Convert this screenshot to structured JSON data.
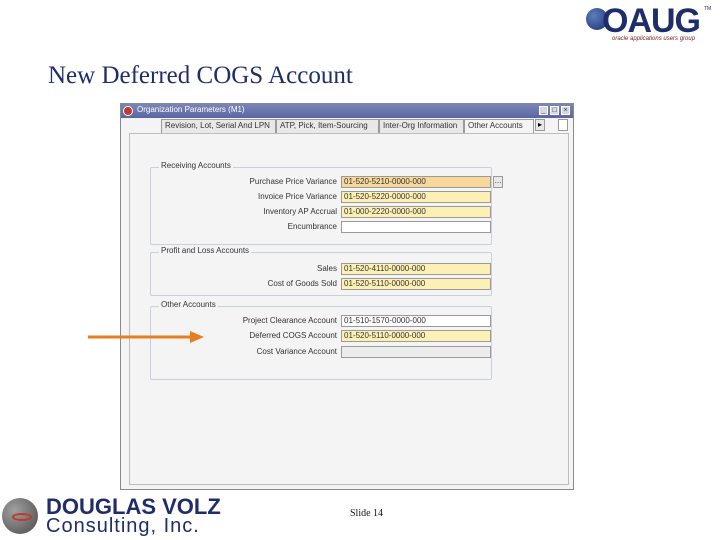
{
  "slide": {
    "title": "New Deferred COGS Account",
    "slide_number": "Slide 14"
  },
  "header_logo": {
    "brand": "OAUG",
    "tagline": "oracle applications users group",
    "trademark": "TM"
  },
  "footer_logo": {
    "name": "DOUGLAS VOLZ",
    "subtitle": "Consulting, Inc."
  },
  "window": {
    "title": "Organization Parameters (M1)",
    "controls": [
      "_",
      "□",
      "×"
    ],
    "tabs": [
      {
        "label": "Revision, Lot, Serial And LPN",
        "active": false
      },
      {
        "label": "ATP, Pick, Item-Sourcing",
        "active": false
      },
      {
        "label": "Inter-Org Information",
        "active": false
      },
      {
        "label": "Other Accounts",
        "active": true
      }
    ],
    "tab_more": "▸"
  },
  "groups": [
    {
      "label": "Receiving Accounts",
      "fields": [
        {
          "label": "Purchase Price Variance",
          "value": "01-520-5210-0000-000",
          "style": "selected",
          "lov": true
        },
        {
          "label": "Invoice Price Variance",
          "value": "01-520-5220-0000-000",
          "style": "req"
        },
        {
          "label": "Inventory AP Accrual",
          "value": "01-000-2220-0000-000",
          "style": "req"
        },
        {
          "label": "Encumbrance",
          "value": "",
          "style": "opt"
        }
      ]
    },
    {
      "label": "Profit and Loss Accounts",
      "fields": [
        {
          "label": "Sales",
          "value": "01-520-4110-0000-000",
          "style": "req"
        },
        {
          "label": "Cost of Goods Sold",
          "value": "01-520-5110-0000-000",
          "style": "req"
        }
      ]
    },
    {
      "label": "Other Accounts",
      "fields": [
        {
          "label": "Project Clearance Account",
          "value": "01-510-1570-0000-000",
          "style": "opt"
        },
        {
          "label": "Deferred COGS Account",
          "value": "01-520-5110-0000-000",
          "style": "req"
        },
        {
          "label": "Cost Variance Account",
          "value": "",
          "style": "ro"
        }
      ]
    }
  ],
  "colors": {
    "title": "#1f2d6b",
    "required_field": "#fdf0b4",
    "arrow": "#e67e22"
  }
}
